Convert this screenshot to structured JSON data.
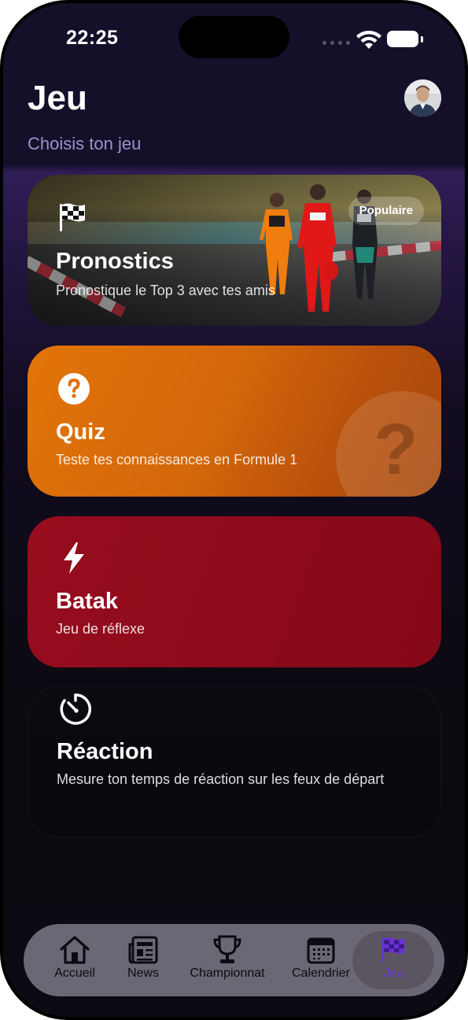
{
  "status_bar": {
    "time": "22:25"
  },
  "header": {
    "title": "Jeu",
    "subtitle": "Choisis ton jeu"
  },
  "cards": [
    {
      "id": "pronostics",
      "icon": "checkered-flag-icon",
      "title": "Pronostics",
      "description": "Pronostique le Top 3 avec tes amis",
      "badge": "Populaire"
    },
    {
      "id": "quiz",
      "icon": "question-circle-icon",
      "title": "Quiz",
      "description": "Teste tes connaissances en Formule 1",
      "decoration": "?"
    },
    {
      "id": "batak",
      "icon": "lightning-bolt-icon",
      "title": "Batak",
      "description": "Jeu de réflexe"
    },
    {
      "id": "reaction",
      "icon": "timer-icon",
      "title": "Réaction",
      "description": "Mesure ton temps de réaction sur les feux de départ"
    }
  ],
  "tabbar": {
    "items": [
      {
        "label": "Accueil",
        "icon": "house-icon",
        "active": false
      },
      {
        "label": "News",
        "icon": "newspaper-icon",
        "active": false
      },
      {
        "label": "Championnat",
        "icon": "trophy-icon",
        "active": false
      },
      {
        "label": "Calendrier",
        "icon": "calendar-icon",
        "active": false
      },
      {
        "label": "Jeu",
        "icon": "checkered-flag-icon",
        "active": true
      }
    ]
  },
  "colors": {
    "quiz_card": "#e27409",
    "batak_card": "#970d1e",
    "accent_purple": "#6a30d8",
    "subtitle": "#9d93c9"
  }
}
